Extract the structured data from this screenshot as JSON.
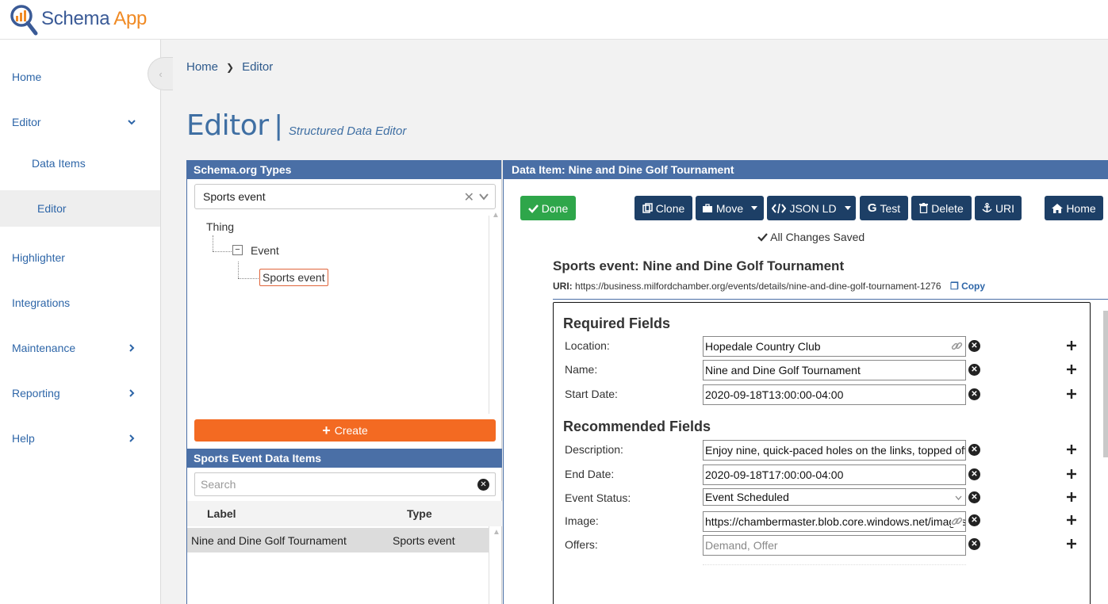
{
  "brand": {
    "name_part1": "Schema",
    "name_part2": "App"
  },
  "sidebar": {
    "items": [
      {
        "label": "Home"
      },
      {
        "label": "Editor"
      },
      {
        "label": "Data Items"
      },
      {
        "label": "Editor"
      },
      {
        "label": "Highlighter"
      },
      {
        "label": "Integrations"
      },
      {
        "label": "Maintenance"
      },
      {
        "label": "Reporting"
      },
      {
        "label": "Help"
      }
    ]
  },
  "breadcrumb": {
    "home": "Home",
    "current": "Editor"
  },
  "page": {
    "title": "Editor",
    "divider": "|",
    "subtitle": "Structured Data Editor"
  },
  "types_panel": {
    "header": "Schema.org Types",
    "selected_type": "Sports event",
    "tree": {
      "root": "Thing",
      "child": "Event",
      "minus": "−",
      "leaf": "Sports event"
    },
    "create_label": "Create"
  },
  "items_panel": {
    "header": "Sports Event Data Items",
    "search_placeholder": "Search",
    "columns": {
      "label": "Label",
      "type": "Type"
    },
    "rows": [
      {
        "label": "Nine and Dine Golf Tournament",
        "type": "Sports event"
      }
    ]
  },
  "data_item": {
    "header": "Data Item: Nine and Dine Golf Tournament",
    "buttons": {
      "done": "Done",
      "clone": "Clone",
      "move": "Move",
      "jsonld": "JSON LD",
      "test": "Test",
      "delete": "Delete",
      "uri": "URI",
      "home": "Home"
    },
    "status": "All Changes Saved",
    "title": "Sports event:  Nine and Dine Golf Tournament",
    "uri_label": "URI:",
    "uri_value": "https://business.milfordchamber.org/events/details/nine-and-dine-golf-tournament-1276",
    "copy_label": "Copy",
    "required_heading": "Required Fields",
    "recommended_heading": "Recommended Fields",
    "required": [
      {
        "label": "Location:",
        "value": "Hopedale Country Club"
      },
      {
        "label": "Name:",
        "value": "Nine and Dine Golf Tournament"
      },
      {
        "label": "Start Date:",
        "value": "2020-09-18T13:00:00-04:00"
      }
    ],
    "recommended": [
      {
        "label": "Description:",
        "value": "Enjoy nine, quick-paced holes on the links, topped off"
      },
      {
        "label": "End Date:",
        "value": "2020-09-18T17:00:00-04:00"
      },
      {
        "label": "Event Status:",
        "value": "Event Scheduled"
      },
      {
        "label": "Image:",
        "value": "https://chambermaster.blob.core.windows.net/images"
      },
      {
        "label": "Offers:",
        "placeholder": "Demand, Offer"
      }
    ]
  },
  "colors": {
    "primary": "#4a6fa6",
    "navy": "#1d3f66",
    "done": "#2ea64a",
    "create": "#f36a22",
    "link": "#2e66a8"
  }
}
